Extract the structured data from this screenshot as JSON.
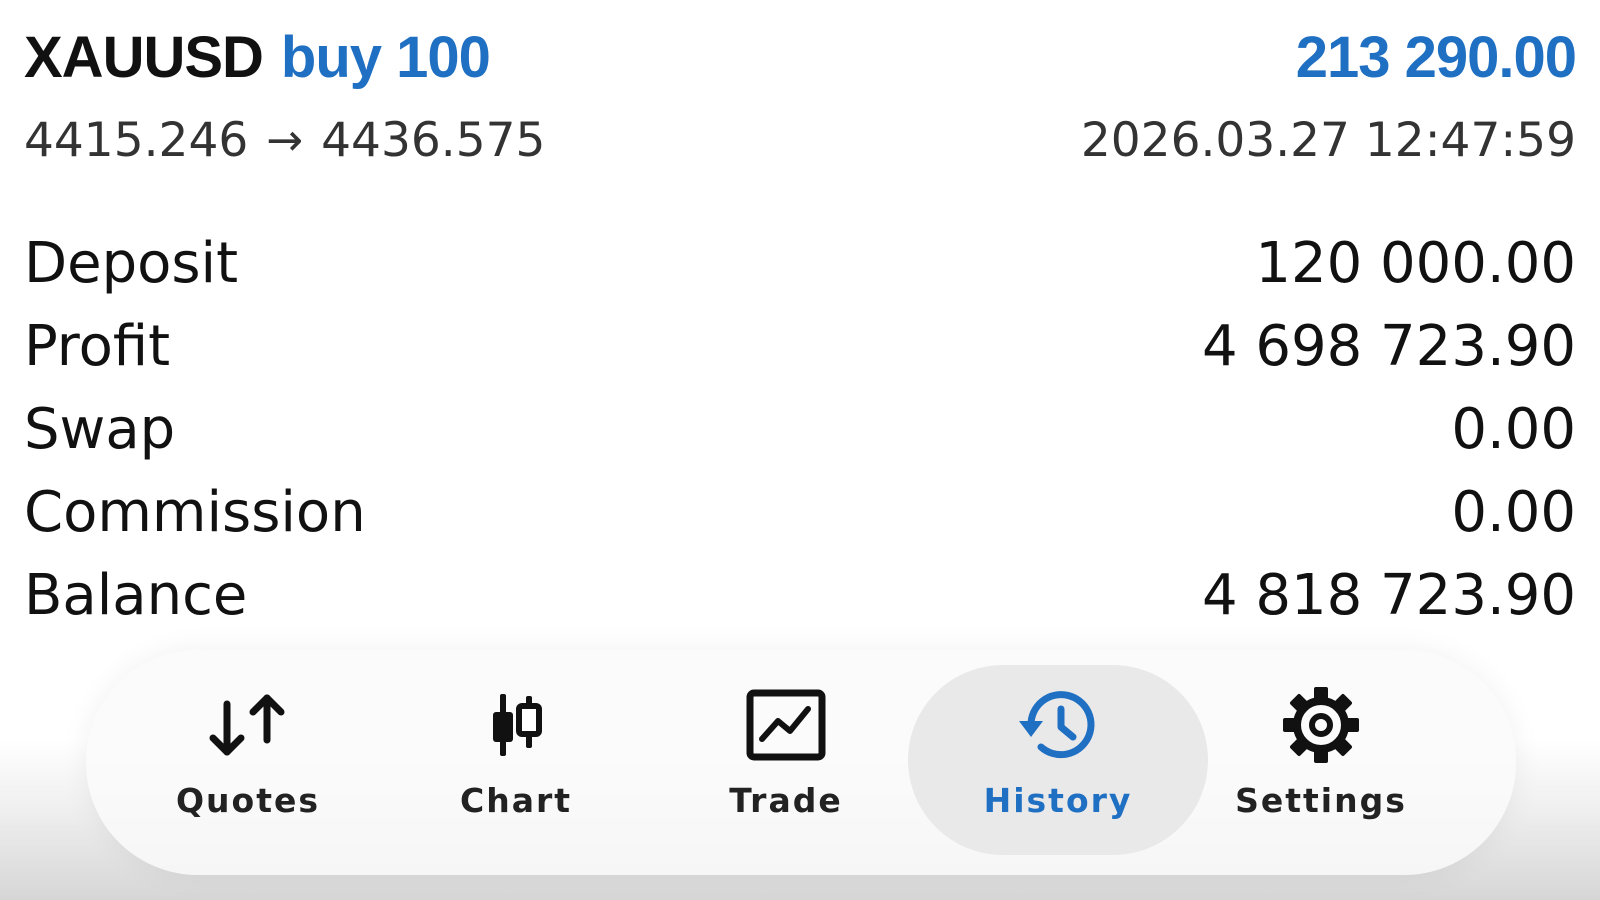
{
  "trade": {
    "symbol": "XAUUSD",
    "side_volume": "buy 100",
    "total_profit": "213 290.00",
    "open_price": "4415.246",
    "arrow": "→",
    "close_price": "4436.575",
    "datetime": "2026.03.27 12:47:59"
  },
  "details": [
    {
      "label": "Deposit",
      "value": "120 000.00"
    },
    {
      "label": "Profit",
      "value": "4 698 723.90"
    },
    {
      "label": "Swap",
      "value": "0.00"
    },
    {
      "label": "Commission",
      "value": "0.00"
    },
    {
      "label": "Balance",
      "value": "4 818 723.90"
    }
  ],
  "tabs": [
    {
      "label": "Quotes",
      "icon": "quotes-arrows-icon"
    },
    {
      "label": "Chart",
      "icon": "candlestick-chart-icon"
    },
    {
      "label": "Trade",
      "icon": "trade-line-chart-icon"
    },
    {
      "label": "History",
      "icon": "history-clock-icon",
      "active": true
    },
    {
      "label": "Settings",
      "icon": "gear-icon"
    }
  ],
  "colors": {
    "accent": "#1f6fc2",
    "text": "#111111",
    "secondary_text": "#333333",
    "active_tab_bg": "#e9e9e9"
  }
}
